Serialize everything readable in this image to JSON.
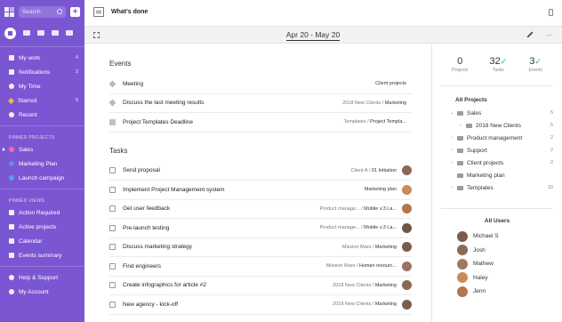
{
  "sidebar": {
    "search_label": "Search",
    "add_label": "+",
    "nav": [
      {
        "label": "My work",
        "count": "4",
        "icon": "check-icon"
      },
      {
        "label": "Notifications",
        "count": "2",
        "icon": "bell-icon"
      },
      {
        "label": "My Time",
        "count": "",
        "icon": "clock-icon"
      },
      {
        "label": "Starred",
        "count": "5",
        "icon": "star-icon"
      },
      {
        "label": "Recent",
        "count": "",
        "icon": "history-icon"
      }
    ],
    "pinned_projects_title": "PINNED PROJECTS",
    "pinned_projects": [
      {
        "label": "Sales",
        "color": "#f26b9a",
        "active": true
      },
      {
        "label": "Marketing Plan",
        "color": "#5b8def"
      },
      {
        "label": "Launch campaign",
        "color": "#4fa3e8"
      }
    ],
    "pinned_views_title": "PINNED VIEWS",
    "pinned_views": [
      {
        "label": "Action Required",
        "icon": "flag-icon"
      },
      {
        "label": "Active projects",
        "icon": "folder-icon"
      },
      {
        "label": "Calendar",
        "icon": "calendar-icon"
      },
      {
        "label": "Events summary",
        "icon": "list-icon"
      }
    ],
    "bottom": [
      {
        "label": "Help & Support",
        "icon": "help-icon"
      },
      {
        "label": "My Account",
        "icon": "account-icon"
      }
    ]
  },
  "header": {
    "title": "What's done",
    "date_range": "Apr 20 - May 20"
  },
  "events": {
    "title": "Events",
    "rows": [
      {
        "title": "Meeting",
        "crumb_path": "",
        "crumb_last": "Client projects",
        "type": "event"
      },
      {
        "title": "Discuss the last meeting results",
        "crumb_path": "2018 New Clients / ",
        "crumb_last": "Marketing",
        "type": "event"
      },
      {
        "title": "Project Templates Deadline",
        "crumb_path": "Templates / ",
        "crumb_last": "Project Templa...",
        "type": "task"
      }
    ]
  },
  "tasks": {
    "title": "Tasks",
    "rows": [
      {
        "title": "Send proposal",
        "crumb_path": "Client A / ",
        "crumb_last": "01 Initiation",
        "avatar": "#8a6a55"
      },
      {
        "title": "Implement Project Management system",
        "crumb_path": "",
        "crumb_last": "Marketing plan",
        "avatar": "#c98b5a"
      },
      {
        "title": "Get user feedback",
        "crumb_path": "Product manage... / ",
        "crumb_last": "Mobile v.3 La...",
        "avatar": "#b5764d"
      },
      {
        "title": "Pre-launch testing",
        "crumb_path": "Product manage... / ",
        "crumb_last": "Mobile v.3 La...",
        "avatar": "#6e5446"
      },
      {
        "title": "Discuss marketing strategy",
        "crumb_path": "Mission Mars / ",
        "crumb_last": "Marketing",
        "avatar": "#7c5b4a"
      },
      {
        "title": "Find engineers",
        "crumb_path": "Mission Mars / ",
        "crumb_last": "Human resourc...",
        "avatar": "#9a7462"
      },
      {
        "title": "Create infographics for article #2",
        "crumb_path": "2018 New Clients / ",
        "crumb_last": "Marketing",
        "avatar": "#8d6752"
      },
      {
        "title": "New agency - kick-off",
        "crumb_path": "2018 New Clients / ",
        "crumb_last": "Marketing",
        "avatar": "#7b5e4e"
      }
    ]
  },
  "stats": [
    {
      "num": "0",
      "label": "Projects",
      "green": false
    },
    {
      "num": "32",
      "label": "Tasks",
      "green": true
    },
    {
      "num": "3",
      "label": "Events",
      "green": true
    }
  ],
  "projects": {
    "title": "All Projects",
    "rows": [
      {
        "name": "Sales",
        "count": "5",
        "chevron": "⌄",
        "indent": 0
      },
      {
        "name": "2018 New Clients",
        "count": "5",
        "chevron": "›",
        "indent": 1
      },
      {
        "name": "Product management",
        "count": "2",
        "chevron": "›",
        "indent": 0
      },
      {
        "name": "Support",
        "count": "2",
        "chevron": "›",
        "indent": 0
      },
      {
        "name": "Client projects",
        "count": "2",
        "chevron": "›",
        "indent": 0
      },
      {
        "name": "Marketing plan",
        "count": "",
        "chevron": "",
        "indent": 0
      },
      {
        "name": "Templates",
        "count": "10",
        "chevron": "›",
        "indent": 0
      }
    ]
  },
  "users": {
    "title": "All Users",
    "rows": [
      {
        "name": "Michael S",
        "avatar": "#7c5b4a"
      },
      {
        "name": "Josh",
        "avatar": "#8a6a55"
      },
      {
        "name": "Mathew",
        "avatar": "#a07860"
      },
      {
        "name": "Haley",
        "avatar": "#c98b5a"
      },
      {
        "name": "Jenn",
        "avatar": "#b5764d"
      }
    ]
  }
}
